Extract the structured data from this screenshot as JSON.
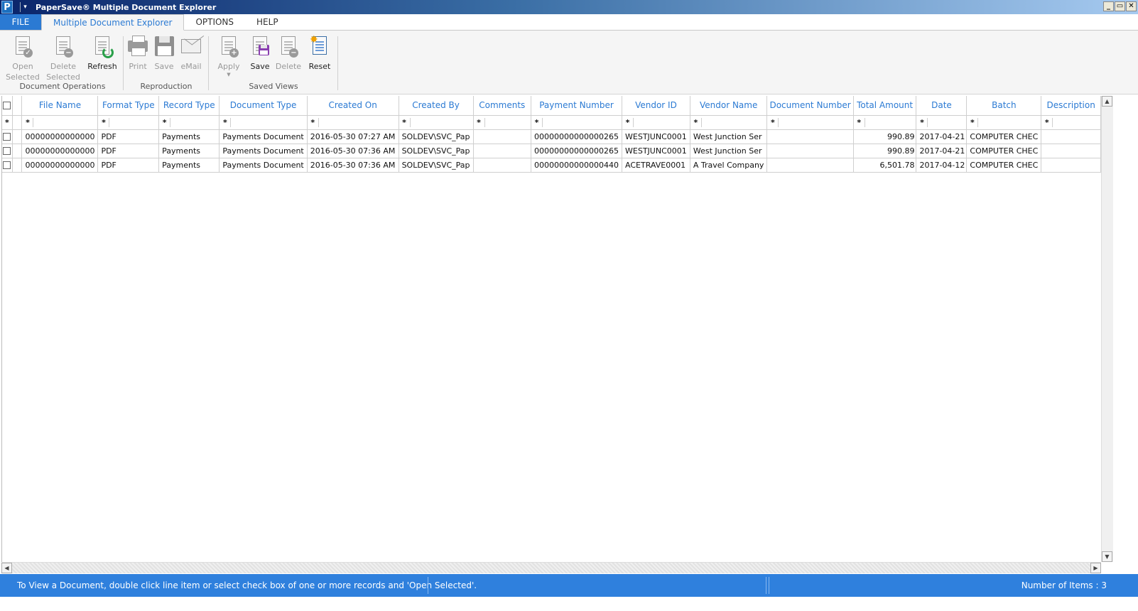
{
  "window": {
    "title": "PaperSave® Multiple Document Explorer",
    "app_icon_letter": "P",
    "buttons": [
      "_",
      "▭",
      "✕"
    ]
  },
  "tabs": [
    {
      "label": "FILE"
    },
    {
      "label": "Multiple Document Explorer"
    },
    {
      "label": "OPTIONS"
    },
    {
      "label": "HELP"
    }
  ],
  "ribbon": {
    "groups": [
      {
        "label": "Document Operations",
        "buttons": [
          {
            "label": "Open\nSelected",
            "icon": "open-document-icon",
            "enabled": false
          },
          {
            "label": "Delete\nSelected",
            "icon": "delete-document-icon",
            "enabled": false
          },
          {
            "label": "Refresh",
            "icon": "refresh-icon",
            "enabled": true
          }
        ]
      },
      {
        "label": "Reproduction",
        "buttons": [
          {
            "label": "Print",
            "icon": "printer-icon",
            "enabled": false
          },
          {
            "label": "Save",
            "icon": "floppy-disk-icon",
            "enabled": false
          },
          {
            "label": "eMail",
            "icon": "envelope-icon",
            "enabled": false
          }
        ]
      },
      {
        "label": "Saved Views",
        "buttons": [
          {
            "label": "Apply",
            "icon": "apply-view-icon",
            "enabled": false
          },
          {
            "label": "Save",
            "icon": "save-view-icon",
            "enabled": true
          },
          {
            "label": "Delete",
            "icon": "delete-view-icon",
            "enabled": false
          },
          {
            "label": "Reset",
            "icon": "reset-view-icon",
            "enabled": true
          }
        ]
      }
    ]
  },
  "grid": {
    "columns": [
      "File Name",
      "Format Type",
      "Record Type",
      "Document Type",
      "Created On",
      "Created By",
      "Comments",
      "Payment Number",
      "Vendor ID",
      "Vendor Name",
      "Document Number",
      "Total Amount",
      "Date",
      "Batch",
      "Description"
    ],
    "filter_symbol": "*",
    "rows": [
      [
        "00000000000000",
        "PDF",
        "Payments",
        "Payments Document",
        "2016-05-30 07:27 AM",
        "SOLDEV\\SVC_Pap",
        "",
        "00000000000000265",
        "WESTJUNC0001",
        "West Junction Ser",
        "",
        "990.89",
        "2017-04-21",
        "COMPUTER CHEC",
        ""
      ],
      [
        "00000000000000",
        "PDF",
        "Payments",
        "Payments Document",
        "2016-05-30 07:36 AM",
        "SOLDEV\\SVC_Pap",
        "",
        "00000000000000265",
        "WESTJUNC0001",
        "West Junction Ser",
        "",
        "990.89",
        "2017-04-21",
        "COMPUTER CHEC",
        ""
      ],
      [
        "00000000000000",
        "PDF",
        "Payments",
        "Payments Document",
        "2016-05-30 07:36 AM",
        "SOLDEV\\SVC_Pap",
        "",
        "00000000000000440",
        "ACETRAVE0001",
        "A Travel Company",
        "",
        "6,501.78",
        "2017-04-12",
        "COMPUTER CHEC",
        ""
      ]
    ]
  },
  "status": {
    "message": "To View a Document, double click line item or select check box of one or more records and 'Open Selected'.",
    "count": "Number of Items : 3"
  }
}
